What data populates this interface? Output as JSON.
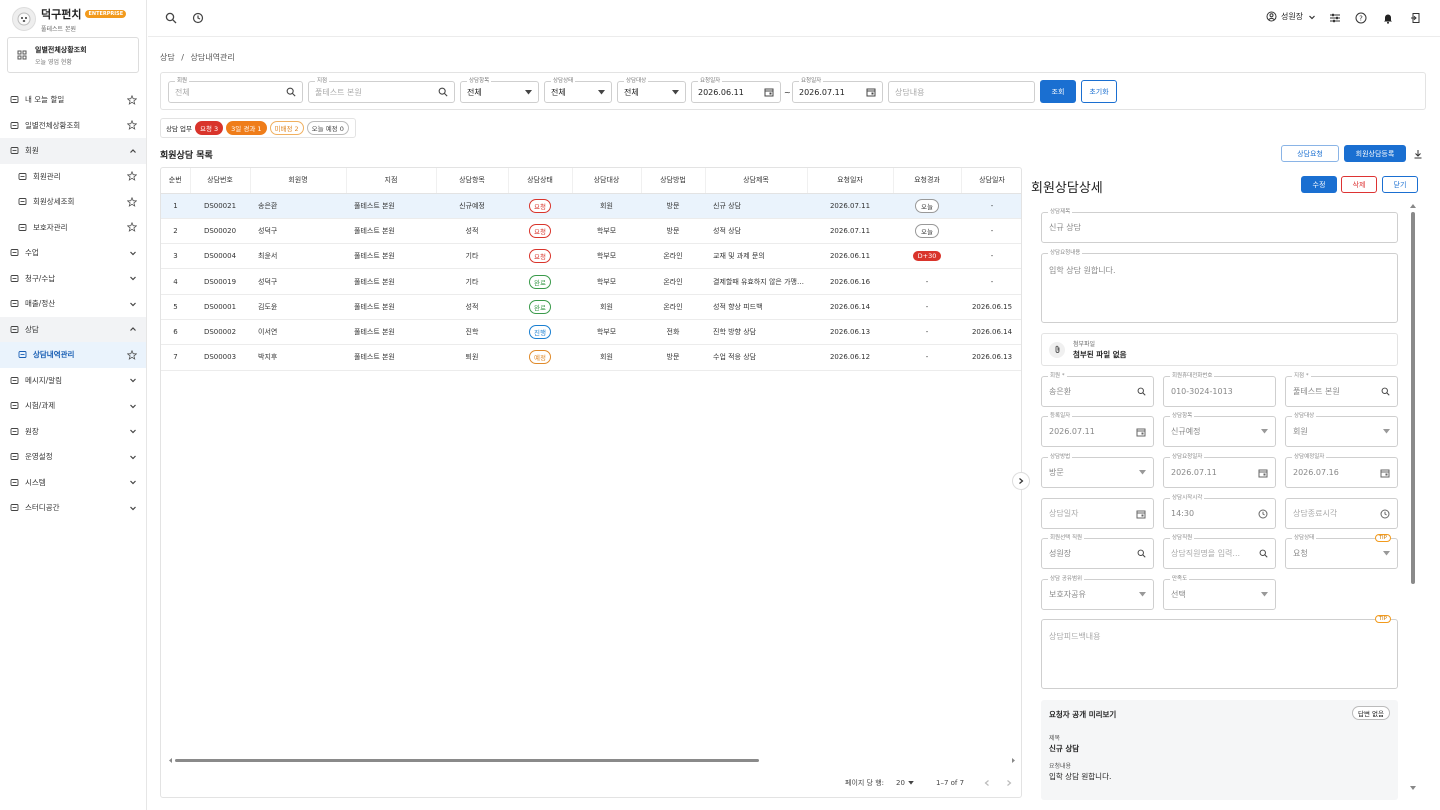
{
  "brand": {
    "name": "덕구펀치",
    "badge": "ENTERPRISE",
    "branch": "풀테스트 본원"
  },
  "quick": {
    "title": "일별전체상황조회",
    "subtitle": "오늘 영업 현황"
  },
  "nav": [
    {
      "label": "내 오늘 할일",
      "icon": "checklist-icon",
      "star": true
    },
    {
      "label": "일별전체상황조회",
      "icon": "dashboard-icon",
      "star": true
    },
    {
      "label": "회원",
      "icon": "users-icon",
      "chevron": "up",
      "open": true
    },
    {
      "label": "회원관리",
      "icon": "user-group-icon",
      "star": true,
      "sub": true
    },
    {
      "label": "회원상세조회",
      "icon": "user-search-icon",
      "star": true,
      "sub": true
    },
    {
      "label": "보호자관리",
      "icon": "guardian-icon",
      "star": true,
      "sub": true
    },
    {
      "label": "수업",
      "icon": "class-icon",
      "chevron": "down"
    },
    {
      "label": "청구/수납",
      "icon": "billing-icon",
      "chevron": "down"
    },
    {
      "label": "매출/정산",
      "icon": "chart-icon",
      "chevron": "down"
    },
    {
      "label": "상담",
      "icon": "headset-icon",
      "chevron": "up",
      "open": true
    },
    {
      "label": "상담내역관리",
      "icon": "chat-icon",
      "star": true,
      "sub": true,
      "active": true
    },
    {
      "label": "메시지/알림",
      "icon": "message-icon",
      "chevron": "down"
    },
    {
      "label": "시험/과제",
      "icon": "exam-icon",
      "chevron": "down"
    },
    {
      "label": "원장",
      "icon": "ledger-icon",
      "chevron": "down"
    },
    {
      "label": "운영설정",
      "icon": "folder-icon",
      "chevron": "down"
    },
    {
      "label": "시스템",
      "icon": "gear-icon",
      "chevron": "down"
    },
    {
      "label": "스터디공간",
      "icon": "room-icon",
      "chevron": "down"
    }
  ],
  "topbar": {
    "user": "성원장"
  },
  "breadcrumb": {
    "parent": "상담",
    "sep": "/",
    "current": "상담내역관리"
  },
  "filters": {
    "member": {
      "label": "회원",
      "value": "전체"
    },
    "branch": {
      "label": "지점",
      "placeholder": "풀테스트 본원"
    },
    "category": {
      "label": "상담항목",
      "value": "전체"
    },
    "status": {
      "label": "상담상태",
      "value": "전체"
    },
    "target": {
      "label": "상담대상",
      "value": "전체"
    },
    "date_from": {
      "label": "요청일자",
      "value": "2026.06.11"
    },
    "tilde": "~",
    "date_to": {
      "label": "요청일자",
      "value": "2026.07.11"
    },
    "content": {
      "placeholder": "상담내용"
    },
    "search_btn": "조회",
    "reset_btn": "초기화"
  },
  "chips": {
    "label": "상담 업무",
    "items": [
      {
        "text": "요청 3",
        "bg": "#d9342b",
        "fg": "#ffffff",
        "border": "#d9342b"
      },
      {
        "text": "3일 경과 1",
        "bg": "#ef7d1a",
        "fg": "#ffffff",
        "border": "#ef7d1a"
      },
      {
        "text": "미배정 2",
        "bg": "#ffffff",
        "fg": "#e08a2a",
        "border": "#f0b060"
      },
      {
        "text": "오늘 예정 0",
        "bg": "#ffffff",
        "fg": "#444444",
        "border": "#bbbbbb"
      }
    ]
  },
  "list": {
    "title": "회원상담 목록",
    "request_btn": "상담요청",
    "register_btn": "회원상담등록"
  },
  "table": {
    "headers": [
      "순번",
      "상담번호",
      "회원명",
      "지점",
      "상담항목",
      "상담상태",
      "상담대상",
      "상담방법",
      "상담제목",
      "요청일자",
      "요청경과",
      "상담일자"
    ],
    "rows": [
      {
        "no": "1",
        "id": "DS00021",
        "name": "송은환",
        "branch": "풀테스트 본원",
        "cat": "신규예정",
        "status": "요청",
        "target": "회원",
        "method": "방문",
        "title": "신규 상담",
        "req": "2026.07.11",
        "elapsed": "오늘",
        "date": "-"
      },
      {
        "no": "2",
        "id": "DS00020",
        "name": "성덕구",
        "branch": "풀테스트 본원",
        "cat": "성적",
        "status": "요청",
        "target": "학부모",
        "method": "방문",
        "title": "성적 상담",
        "req": "2026.07.11",
        "elapsed": "오늘",
        "date": "-"
      },
      {
        "no": "3",
        "id": "DS00004",
        "name": "최윤서",
        "branch": "풀테스트 본원",
        "cat": "기타",
        "status": "요청",
        "target": "학부모",
        "method": "온라인",
        "title": "교재 및 과제 문의",
        "req": "2026.06.11",
        "elapsed": "D+30",
        "date": "-"
      },
      {
        "no": "4",
        "id": "DS00019",
        "name": "성덕구",
        "branch": "풀테스트 본원",
        "cat": "기타",
        "status": "완료",
        "target": "학부모",
        "method": "온라인",
        "title": "결제할때 유효하지 않은 가맹점이...",
        "req": "2026.06.16",
        "elapsed": "-",
        "date": "-"
      },
      {
        "no": "5",
        "id": "DS00001",
        "name": "김도윤",
        "branch": "풀테스트 본원",
        "cat": "성적",
        "status": "완료",
        "target": "회원",
        "method": "온라인",
        "title": "성적 향상 피드백",
        "req": "2026.06.14",
        "elapsed": "-",
        "date": "2026.06.15"
      },
      {
        "no": "6",
        "id": "DS00002",
        "name": "이서연",
        "branch": "풀테스트 본원",
        "cat": "진학",
        "status": "진행",
        "target": "학부모",
        "method": "전화",
        "title": "진학 방향 상담",
        "req": "2026.06.13",
        "elapsed": "-",
        "date": "2026.06.14"
      },
      {
        "no": "7",
        "id": "DS00003",
        "name": "박지후",
        "branch": "풀테스트 본원",
        "cat": "퇴원",
        "status": "예정",
        "target": "회원",
        "method": "방문",
        "title": "수업 적응 상담",
        "req": "2026.06.12",
        "elapsed": "-",
        "date": "2026.06.13"
      }
    ]
  },
  "status_colors": {
    "요청": "#d9342b",
    "완료": "#3a9a4a",
    "진행": "#1a7fd1",
    "예정": "#e08a2a"
  },
  "pager": {
    "label": "페이지 당 행:",
    "size": "20",
    "range": "1–7 of 7"
  },
  "detail": {
    "title": "회원상담상세",
    "edit_btn": "수정",
    "delete_btn": "삭제",
    "close_btn": "닫기",
    "subject": {
      "label": "상담제목",
      "value": "신규 상담"
    },
    "request_content": {
      "label": "상담요청내용",
      "value": "입학 상담 원합니다."
    },
    "attach": {
      "label": "첨부파일",
      "value": "첨부된 파일 없음"
    },
    "member": {
      "label": "회원 *",
      "value": "송은환"
    },
    "phone": {
      "label": "회원휴대전화번호",
      "value": "010-3024-1013"
    },
    "branch": {
      "label": "지점 *",
      "value": "풀테스트 본원"
    },
    "reg_date": {
      "label": "등록일자",
      "value": "2026.07.11"
    },
    "category": {
      "label": "상담항목",
      "value": "신규예정"
    },
    "target": {
      "label": "상담대상",
      "value": "회원"
    },
    "method": {
      "label": "상담방법",
      "value": "방문"
    },
    "req_date": {
      "label": "상담요청일자",
      "value": "2026.07.11"
    },
    "plan_date": {
      "label": "상담예정일자",
      "value": "2026.07.16"
    },
    "counsel_date": {
      "placeholder": "상담일자"
    },
    "start_time": {
      "label": "상담시작시각",
      "value": "14:30"
    },
    "end_time": {
      "placeholder": "상담종료시각"
    },
    "assignee": {
      "label": "회원선택 직원",
      "value": "성원장"
    },
    "staff": {
      "label": "상담직원",
      "placeholder": "상담직원명을 입력..."
    },
    "state": {
      "label": "상담상태",
      "value": "요청",
      "tip": "TIP"
    },
    "share": {
      "label": "상담 공유범위",
      "value": "보호자공유"
    },
    "satisfaction": {
      "label": "만족도",
      "value": "선택"
    },
    "feedback": {
      "placeholder": "상담피드백내용",
      "tip": "TIP"
    },
    "preview": {
      "title": "요청자 공개 미리보기",
      "badge": "답변 없음",
      "subject_label": "제목",
      "subject": "신규 상담",
      "content_label": "요청내용",
      "content": "입학 상담 원합니다."
    }
  }
}
